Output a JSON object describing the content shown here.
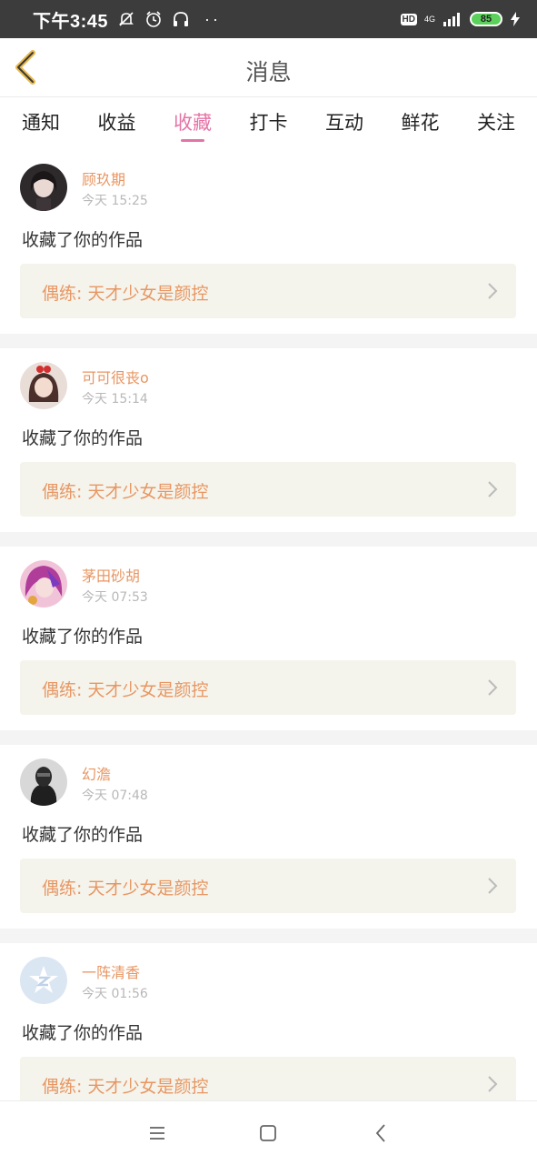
{
  "status_bar": {
    "time": "下午3:45",
    "hd_label": "HD",
    "network_label": "4G",
    "battery": "85",
    "icons": [
      "mute-bell-icon",
      "alarm-icon",
      "headphones-icon",
      "signal-icon",
      "charging-icon"
    ]
  },
  "header": {
    "title": "消息",
    "back_icon": "chevron-left-icon"
  },
  "tabs": [
    "通知",
    "收益",
    "收藏",
    "打卡",
    "互动",
    "鲜花",
    "关注"
  ],
  "active_tab": "收藏",
  "colors": {
    "accent_pink": "#e574a6",
    "username_orange": "#e89662",
    "work_bg": "#f4f4ec"
  },
  "messages": [
    {
      "user": "顾玖期",
      "time": "今天 15:25",
      "action": "收藏了你的作品",
      "work": "偶练: 天才少女是颜控"
    },
    {
      "user": "可可很丧o",
      "time": "今天 15:14",
      "action": "收藏了你的作品",
      "work": "偶练: 天才少女是颜控"
    },
    {
      "user": "茅田砂胡",
      "time": "今天 07:53",
      "action": "收藏了你的作品",
      "work": "偶练: 天才少女是颜控"
    },
    {
      "user": "幻澹",
      "time": "今天 07:48",
      "action": "收藏了你的作品",
      "work": "偶练: 天才少女是颜控"
    },
    {
      "user": "一阵清香",
      "time": "今天 01:56",
      "action": "收藏了你的作品",
      "work": "偶练: 天才少女是颜控"
    }
  ],
  "nav_bar": {
    "icons": [
      "menu-icon",
      "home-square-icon",
      "back-triangle-icon"
    ]
  }
}
